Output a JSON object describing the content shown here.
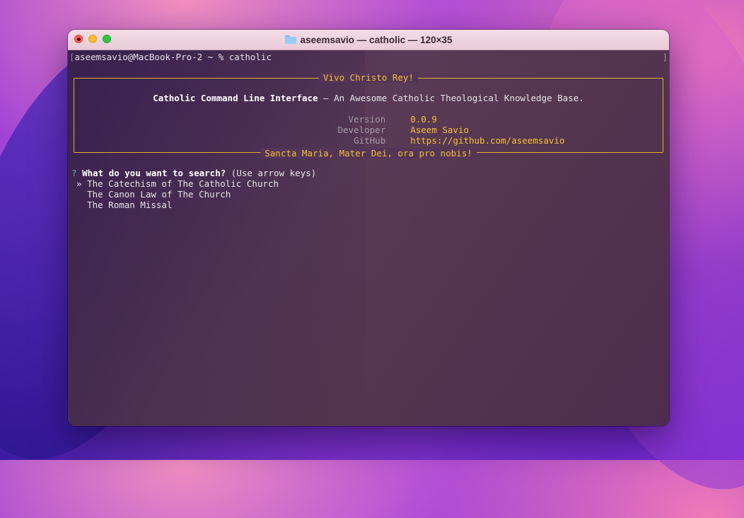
{
  "window": {
    "title": "aseemsavio — catholic — 120×35",
    "folder_icon": "folder-icon"
  },
  "terminal": {
    "prompt": "aseemsavio@MacBook-Pro-2 ~ % catholic",
    "box": {
      "title": "Vivo Christo Rey!",
      "heading_bold": "Catholic Command Line Interface",
      "heading_rest": " — An Awesome Catholic Theological Knowledge Base.",
      "version_label": "Version",
      "version_value": "0.0.9",
      "developer_label": "Developer",
      "developer_value": "Aseem Savio",
      "github_label": "GitHub",
      "github_value": "https://github.com/aseemsavio",
      "footer": "Sancta Maria, Mater Dei, ora pro nobis!"
    },
    "question": {
      "mark": "?",
      "text": "What do you want to search?",
      "hint": "(Use arrow keys)"
    },
    "options": [
      {
        "label": "The Catechism of The Catholic Church",
        "selected": true,
        "pointer": "»"
      },
      {
        "label": "The Canon Law of The Church",
        "selected": false
      },
      {
        "label": "The Roman Missal",
        "selected": false
      }
    ]
  },
  "colors": {
    "accent_yellow": "#f1c232",
    "border_yellow": "#e2b12c",
    "question_mark": "#5fa8c8"
  }
}
